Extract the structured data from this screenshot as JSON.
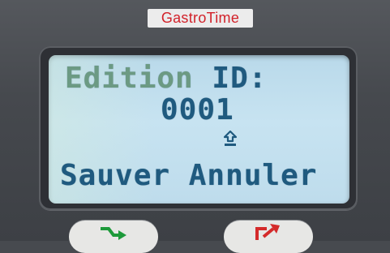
{
  "device": {
    "brand": "GastroTime"
  },
  "lcd": {
    "line1_word": "Edition",
    "line1_label": "ID:",
    "id_value": "0001",
    "cursor_icon": "up-arrow-icon",
    "save_label": "Sauver",
    "cancel_label": "Annuler"
  },
  "buttons": [
    {
      "icon": "enter-arrow-icon",
      "color": "#1d9a3a"
    },
    {
      "icon": "exit-arrow-icon",
      "color": "#d42a2a"
    }
  ],
  "colors": {
    "lcd_text": "#1f5a7f",
    "lcd_bg": "#c3e0ef",
    "brand_red": "#d2222a"
  }
}
